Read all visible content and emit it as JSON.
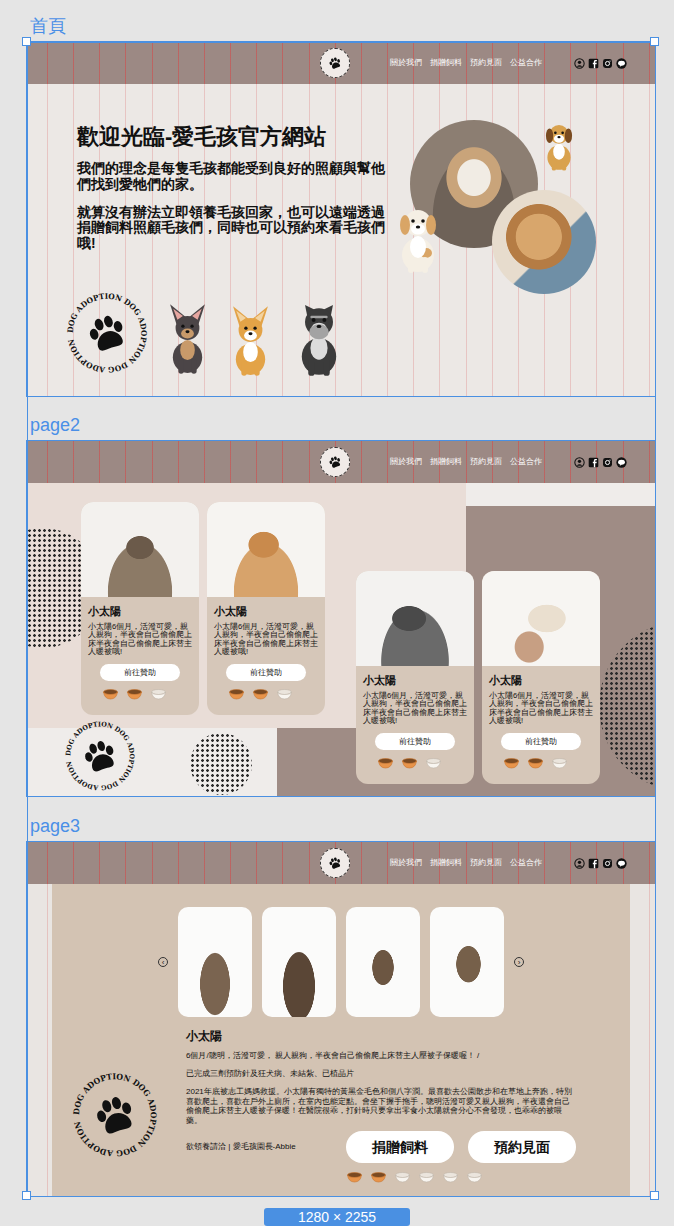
{
  "canvas": {
    "size_badge": "1280 × 2255"
  },
  "frames": [
    {
      "label": "首頁",
      "nav": [
        "關於我們",
        "捐贈飼料",
        "預約見面",
        "公益合作"
      ]
    },
    {
      "label": "page2",
      "nav": [
        "關於我們",
        "捐贈飼料",
        "預約見面",
        "公益合作"
      ]
    },
    {
      "label": "page3",
      "nav": [
        "關於我們",
        "捐贈飼料",
        "預約見面",
        "公益合作"
      ]
    }
  ],
  "home": {
    "title": "歡迎光臨-愛毛孩官方網站",
    "paragraphs": [
      "我們的理念是每隻毛孩都能受到良好的照顧與幫他們找到愛牠們的家。",
      "就算沒有辦法立即領養毛孩回家，也可以遠端透過捐贈飼料照顧毛孩們，同時也可以預約來看毛孩們哦!"
    ],
    "badge": "DOG ADOPTION DOG ADOPTION DOG ADOPTION"
  },
  "page2": {
    "badge": "DOG ADOPTION DOG ADOPTION DOG ADOPTION",
    "cards": [
      {
        "name": "小太陽",
        "description": "小太陽6個月，活潑可愛，親人親狗，半夜會自己偷偷爬上床半夜會自己偷偷爬上床替主人暖被哦!",
        "button": "前往贊助",
        "bowls": [
          true,
          true,
          false
        ]
      },
      {
        "name": "小太陽",
        "description": "小太陽6個月，活潑可愛，親人親狗，半夜會自己偷偷爬上床半夜會自己偷偷爬上床替主人暖被哦!",
        "button": "前往贊助",
        "bowls": [
          true,
          true,
          false
        ]
      },
      {
        "name": "小太陽",
        "description": "小太陽6個月，活潑可愛，親人親狗，半夜會自己偷偷爬上床半夜會自己偷偷爬上床替主人暖被哦!",
        "button": "前往贊助",
        "bowls": [
          true,
          true,
          false
        ]
      },
      {
        "name": "小太陽",
        "description": "小太陽6個月，活潑可愛，親人親狗，半夜會自己偷偷爬上床半夜會自己偷偷爬上床替主人暖被哦!",
        "button": "前往贊助",
        "bowls": [
          true,
          true,
          false
        ]
      }
    ]
  },
  "page3": {
    "prev": "‹",
    "next": "›",
    "name": "小太陽",
    "lines": [
      "6個月/聰明，活潑可愛， 親人親狗，半夜會自己偷偷爬上床替主人壓被子保暖喔！ /",
      "已完成三劑預防針及狂犬病、未結紮、已植晶片"
    ],
    "story": "2021年底被志工媽媽救援。小太陽有獨特的黃黑金毛色和側八字潤。最喜歡去公園散步和在草地上奔跑，特別喜歡爬土，喜歡在戶外上廁所，在室內也能定點。會坐下握手拖手，聰明活潑可愛又親人親狗，半夜還會自己偷偷爬上床替主人暖被子保暖！在醫院很乖，打針時只要拿出零食小太陽就會分心不會發現，也乖乖的被喂藥。",
    "contact": "欲領養請洽 | 愛毛孩園長-Abbie",
    "buttons": [
      "捐贈飼料",
      "預約見面"
    ],
    "bowls": [
      true,
      true,
      false,
      false,
      false,
      false
    ],
    "badge": "DOG ADOPTION DOG ADOPTION DOG ADOPTION"
  }
}
